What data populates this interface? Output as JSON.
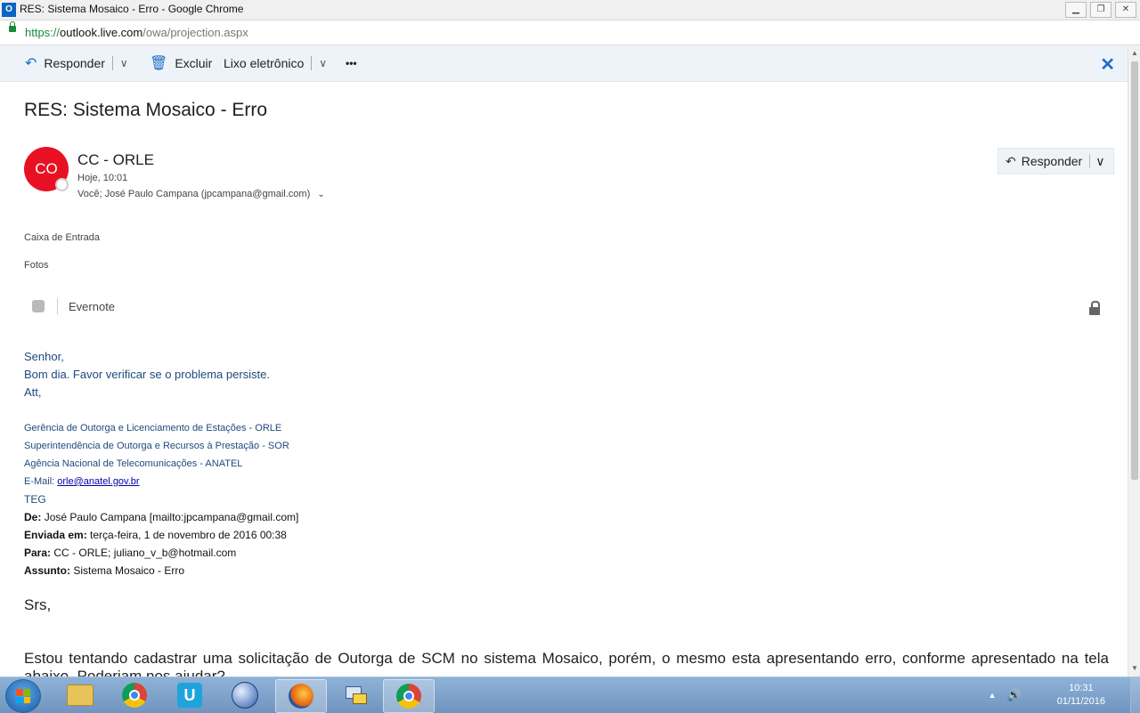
{
  "window": {
    "title": "RES: Sistema Mosaico - Erro - Google Chrome",
    "app_icon_letter": "O"
  },
  "address": {
    "scheme": "https://",
    "host": "outlook.live.com",
    "path": "/owa/projection.aspx"
  },
  "toolbar": {
    "reply_label": "Responder",
    "delete_label": "Excluir",
    "junk_label": "Lixo eletrônico",
    "more_label": "•••",
    "close_label": "✕"
  },
  "message": {
    "subject": "RES: Sistema Mosaico - Erro",
    "avatar_initials": "CO",
    "avatar_color": "#e81123",
    "sender": "CC - ORLE",
    "time": "Hoje, 10:01",
    "recipients": "Você; José Paulo Campana (jpcampana@gmail.com)",
    "reply_button": "Responder",
    "folders": [
      "Caixa de Entrada",
      "Fotos"
    ],
    "addin_label": "Evernote"
  },
  "body": {
    "greeting": "Senhor,",
    "line1": "Bom dia. Favor verificar se o problema persiste.",
    "closing": "Att,",
    "signature": {
      "line1": "Gerência de Outorga e Licenciamento de Estações - ORLE",
      "line2": "Superintendência de Outorga e Recursos à Prestação - SOR",
      "line3": "Agência Nacional de Telecomunicações - ANATEL",
      "email_prefix": "E-Mail: ",
      "email": "orle@anatel.gov.br",
      "teg": "TEG"
    },
    "quoted": {
      "from_label": "De:",
      "from_value": "José Paulo Campana [mailto:jpcampana@gmail.com]",
      "sent_label": "Enviada em:",
      "sent_value": "terça-feira, 1 de novembro de 2016 00:38",
      "to_label": "Para:",
      "to_value": "CC - ORLE; juliano_v_b@hotmail.com",
      "subject_label": "Assunto:",
      "subject_value": "Sistema Mosaico - Erro"
    },
    "srs": "Srs,",
    "paragraph": "Estou tentando cadastrar uma solicitação de Outorga de SCM no sistema Mosaico, porém, o mesmo esta apresentando erro, conforme apresentado na tela abaixo. Poderiam nos ajudar?"
  },
  "taskbar": {
    "time": "10:31",
    "date": "01/11/2016",
    "apps": [
      "folder-icon",
      "chrome-icon",
      "u-app-icon",
      "swirl-app-icon",
      "firefox-icon",
      "network-icon",
      "chrome-icon"
    ]
  }
}
